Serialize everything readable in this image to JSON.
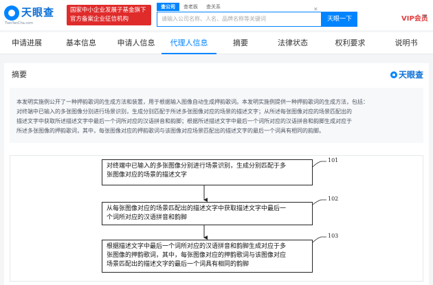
{
  "header": {
    "logo_text": "天眼查",
    "logo_url": "TianYanCha.com",
    "promo_line1": "国家中小企业发展子基金旗下",
    "promo_line2": "官方备案企业征信机构",
    "search_tabs": [
      "查公司",
      "查老板",
      "查关系"
    ],
    "search_placeholder": "请输入公司名称、人名、品牌名称等关键词",
    "search_button": "天眼一下",
    "vip_label": "VIP会员"
  },
  "nav": {
    "items": [
      "申请进展",
      "基本信息",
      "申请人信息",
      "代理人信息",
      "摘要",
      "法律状态",
      "权利要求",
      "说明书"
    ],
    "active": "代理人信息"
  },
  "abstract": {
    "title": "摘要",
    "brand": "天眼查",
    "lines": [
      "本发明实施例公开了一种押韵歌词的生成方法和装置，用于根据输入图像自动生成押韵歌词。本发明实施例提供一种押韵歌词的生成方法，包括：",
      "对终端中已输入的多张图像分别进行场景识别，生成分别匹配于所述多张图像对应的场景的描述文字；从所述每张图像对应的场景匹配出的",
      "描述文字中获取所述描述文字中最后一个词所对应的汉语拼音和韵脚；根据所述描述文字中最后一个词所对应的汉语拼音和韵脚生成对应于",
      "所述多张图像的押韵歌词，其中，每张图像对应的押韵歌词与该图像对应场景匹配出的描述文字的最后一个词具有相同的韵脚。"
    ]
  },
  "figure": {
    "steps": [
      {
        "label": "101",
        "lines": [
          "对终端中已输入的多张图像分别进行场景识别，生成分别匹配于多",
          "张图像对应的场景的描述文字"
        ]
      },
      {
        "label": "102",
        "lines": [
          "从每张图像对应的场景匹配出的描述文字中获取描述文字中最后一",
          "个词所对应的汉语拼音和韵脚"
        ]
      },
      {
        "label": "103",
        "lines": [
          "根据描述文字中最后一个词所对应的汉语拼音和韵脚生成对应于多",
          "张图像的押韵歌词，其中，每张图像对应的押韵歌词与该图像对应",
          "场景匹配出的描述文字的最后一个词具有相同的韵脚"
        ]
      }
    ]
  }
}
